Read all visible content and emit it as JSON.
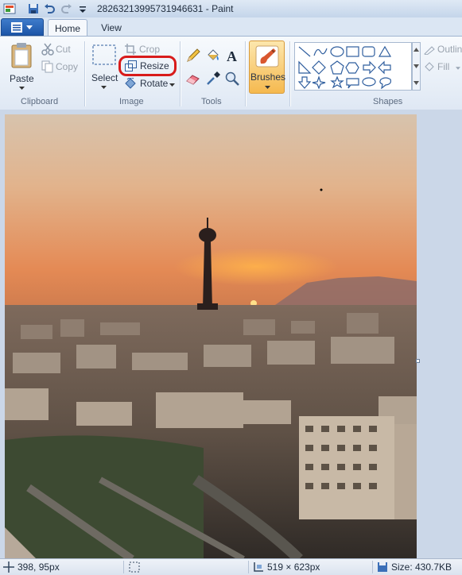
{
  "window": {
    "title": "28263213995731946631 - Paint"
  },
  "tabs": [
    {
      "label": "Home"
    },
    {
      "label": "View"
    }
  ],
  "clipboard": {
    "paste": "Paste",
    "cut": "Cut",
    "copy": "Copy",
    "group_label": "Clipboard"
  },
  "image": {
    "select": "Select",
    "crop": "Crop",
    "resize": "Resize",
    "rotate": "Rotate",
    "group_label": "Image"
  },
  "tools": {
    "group_label": "Tools"
  },
  "brushes": {
    "label": "Brushes"
  },
  "shapes": {
    "outline": "Outline",
    "fill": "Fill",
    "group_label": "Shapes"
  },
  "status": {
    "cursor_pos": "398, 95px",
    "image_size": "519 × 623px",
    "file_size": "Size: 430.7KB"
  },
  "colors": {
    "highlight": "#d81b1b",
    "accent_blue": "#1c55a8",
    "brushes_bg": "#f7c96a"
  }
}
